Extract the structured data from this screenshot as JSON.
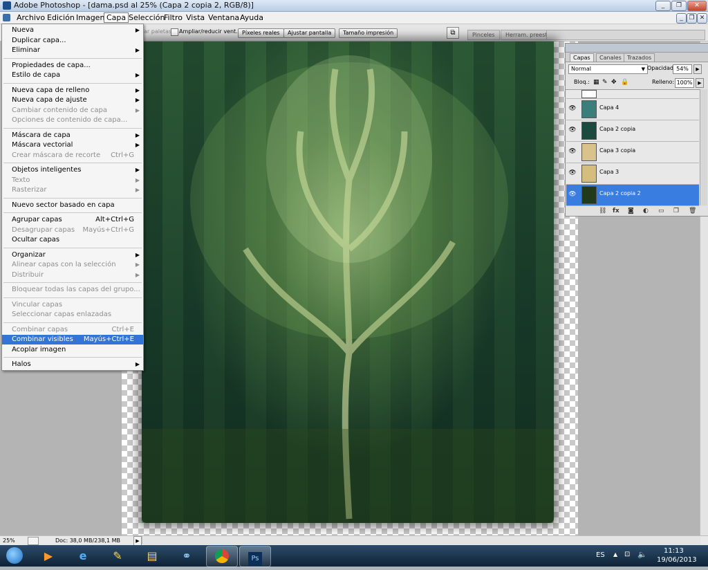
{
  "app": {
    "title": "Adobe Photoshop - [dama.psd al 25% (Capa 2 copia 2, RGB/8)]",
    "win_minimize": "_",
    "win_restore": "❐",
    "win_close": "✕"
  },
  "menubar": {
    "items": [
      "Archivo",
      "Edición",
      "Imagen",
      "Capa",
      "Selección",
      "Filtro",
      "Vista",
      "Ventana",
      "Ayuda"
    ],
    "active": "Capa",
    "doc_minimize": "_",
    "doc_restore": "❐",
    "doc_close": "✕"
  },
  "options_bar": {
    "partial_label": "ar paletas",
    "checkbox_label": "Ampliar/reducir vent.",
    "buttons": [
      "Píxeles reales",
      "Ajustar pantalla",
      "Tamaño impresión"
    ],
    "panel_tabs": [
      "Pinceles",
      "Herram. preest."
    ]
  },
  "capa_menu": {
    "items": [
      {
        "label": "Nueva",
        "submenu": true,
        "disabled": false
      },
      {
        "label": "Duplicar capa...",
        "disabled": false
      },
      {
        "label": "Eliminar",
        "submenu": true,
        "disabled": false
      },
      {
        "sep": true
      },
      {
        "label": "Propiedades de capa...",
        "disabled": false
      },
      {
        "label": "Estilo de capa",
        "submenu": true,
        "disabled": false
      },
      {
        "sep": true
      },
      {
        "label": "Nueva capa de relleno",
        "submenu": true,
        "disabled": false
      },
      {
        "label": "Nueva capa de ajuste",
        "submenu": true,
        "disabled": false
      },
      {
        "label": "Cambiar contenido de capa",
        "submenu": true,
        "disabled": true
      },
      {
        "label": "Opciones de contenido de capa...",
        "disabled": true
      },
      {
        "sep": true
      },
      {
        "label": "Máscara de capa",
        "submenu": true,
        "disabled": false
      },
      {
        "label": "Máscara vectorial",
        "submenu": true,
        "disabled": false
      },
      {
        "label": "Crear máscara de recorte",
        "shortcut": "Ctrl+G",
        "disabled": true
      },
      {
        "sep": true
      },
      {
        "label": "Objetos inteligentes",
        "submenu": true,
        "disabled": false
      },
      {
        "label": "Texto",
        "submenu": true,
        "disabled": true
      },
      {
        "label": "Rasterizar",
        "submenu": true,
        "disabled": true
      },
      {
        "sep": true
      },
      {
        "label": "Nuevo sector basado en capa",
        "disabled": false
      },
      {
        "sep": true
      },
      {
        "label": "Agrupar capas",
        "shortcut": "Alt+Ctrl+G",
        "disabled": false
      },
      {
        "label": "Desagrupar capas",
        "shortcut": "Mayús+Ctrl+G",
        "disabled": true
      },
      {
        "label": "Ocultar capas",
        "disabled": false
      },
      {
        "sep": true
      },
      {
        "label": "Organizar",
        "submenu": true,
        "disabled": false
      },
      {
        "label": "Alinear capas con la selección",
        "submenu": true,
        "disabled": true
      },
      {
        "label": "Distribuir",
        "submenu": true,
        "disabled": true
      },
      {
        "sep": true
      },
      {
        "label": "Bloquear todas las capas del grupo...",
        "disabled": true
      },
      {
        "sep": true
      },
      {
        "label": "Vincular capas",
        "disabled": true
      },
      {
        "label": "Seleccionar capas enlazadas",
        "disabled": true
      },
      {
        "sep": true
      },
      {
        "label": "Combinar capas",
        "shortcut": "Ctrl+E",
        "disabled": true
      },
      {
        "label": "Combinar visibles",
        "shortcut": "Mayús+Ctrl+E",
        "disabled": false,
        "highlighted": true
      },
      {
        "label": "Acoplar imagen",
        "disabled": false
      },
      {
        "sep": true
      },
      {
        "label": "Halos",
        "submenu": true,
        "disabled": false
      }
    ]
  },
  "layers_panel": {
    "tabs": [
      "Capas",
      "Canales",
      "Trazados"
    ],
    "active_tab": "Capas",
    "blend_mode": "Normal",
    "opacity_label": "Opacidad:",
    "opacity_value": "54%",
    "lock_label": "Bloq.:",
    "fill_label": "Relleno:",
    "fill_value": "100%",
    "layers": [
      {
        "name": "Capa 4",
        "thumb_color": "#3b7f7a",
        "selected": false
      },
      {
        "name": "Capa 2 copia",
        "thumb_color": "#1c4a3f",
        "selected": false
      },
      {
        "name": "Capa 3 copia",
        "thumb_color": "#d8c38a",
        "selected": false
      },
      {
        "name": "Capa 3",
        "thumb_color": "#d4bd7f",
        "selected": false
      },
      {
        "name": "Capa 2 copia 2",
        "thumb_color": "#223a1a",
        "selected": true
      }
    ],
    "bottom_icons": [
      "link-icon",
      "fx-icon",
      "mask-icon",
      "adjustment-icon",
      "folder-icon",
      "new-layer-icon",
      "trash-icon"
    ]
  },
  "statusbar": {
    "zoom": "25%",
    "doc_info": "Doc: 38,0 MB/238,1 MB"
  },
  "taskbar": {
    "language": "ES",
    "time": "11:13",
    "date": "19/06/2013",
    "apps": [
      "start-orb-icon",
      "media-player-icon",
      "internet-explorer-icon",
      "paint-icon",
      "explorer-icon",
      "network-icon",
      "chrome-icon",
      "photoshop-icon"
    ]
  },
  "colors": {
    "highlight": "#3375d6",
    "selected_layer": "#3a7de1",
    "taskbar": "#1b3550"
  }
}
